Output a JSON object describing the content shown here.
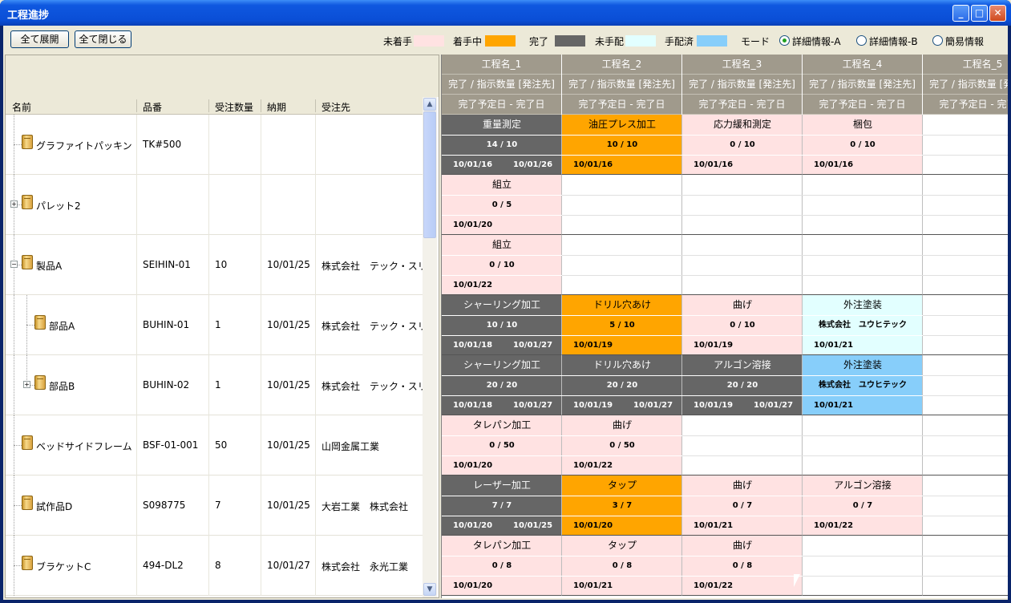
{
  "window": {
    "title": "工程進捗",
    "minimize": "_",
    "maximize": "□",
    "close": "✕"
  },
  "toolbar": {
    "expand_all": "全て展開",
    "collapse_all": "全て閉じる",
    "legend": [
      {
        "label": "未着手",
        "color": "#ffe2e2"
      },
      {
        "label": "着手中",
        "color": "#ffa500"
      },
      {
        "label": "完了",
        "color": "#666666"
      },
      {
        "label": "未手配",
        "color": "#e2ffff"
      },
      {
        "label": "手配済",
        "color": "#87cefa"
      }
    ],
    "mode_label": "モード",
    "modes": [
      {
        "label": "詳細情報-A",
        "selected": true
      },
      {
        "label": "詳細情報-B",
        "selected": false
      },
      {
        "label": "簡易情報",
        "selected": false
      }
    ]
  },
  "left_headers": {
    "name": "名前",
    "part": "品番",
    "qty": "受注数量",
    "due": "納期",
    "customer": "受注先"
  },
  "items": [
    {
      "name": "グラファイトパッキン",
      "part": "TK#500",
      "qty": "",
      "due": "",
      "customer": ""
    },
    {
      "name": "パレット2",
      "part": "",
      "qty": "",
      "due": "",
      "customer": "",
      "expander": "+"
    },
    {
      "name": "製品A",
      "part": "SEIHIN-01",
      "qty": "10",
      "due": "10/01/25",
      "customer": "株式会社　テック・スリー",
      "expander": "−"
    },
    {
      "name": "部品A",
      "part": "BUHIN-01",
      "qty": "1",
      "due": "10/01/25",
      "customer": "株式会社　テック・スリー"
    },
    {
      "name": "部品B",
      "part": "BUHIN-02",
      "qty": "1",
      "due": "10/01/25",
      "customer": "株式会社　テック・スリー",
      "expander": "+"
    },
    {
      "name": "ベッドサイドフレーム",
      "part": "BSF-01-001",
      "qty": "50",
      "due": "10/01/25",
      "customer": "山岡金属工業"
    },
    {
      "name": "試作品D",
      "part": "S098775",
      "qty": "7",
      "due": "10/01/25",
      "customer": "大岩工業　株式会社"
    },
    {
      "name": "ブラケットC",
      "part": "494-DL2",
      "qty": "8",
      "due": "10/01/27",
      "customer": "株式会社　永光工業"
    }
  ],
  "grid_headers": {
    "processes": [
      "工程名_1",
      "工程名_2",
      "工程名_3",
      "工程名_4",
      "工程名_5"
    ],
    "row2": "完了 / 指示数量 [発注先]",
    "row3": "完了予定日 - 完了日"
  },
  "grid": [
    [
      {
        "status": "done",
        "name": "重量測定",
        "qty": "14 / 10",
        "d1": "10/01/16",
        "d2": "10/01/26"
      },
      {
        "status": "progress",
        "name": "油圧プレス加工",
        "qty": "10 / 10",
        "d1": "10/01/16",
        "d2": ""
      },
      {
        "status": "notstart",
        "name": "応力緩和測定",
        "qty": "0 / 10",
        "d1": "10/01/16",
        "d2": ""
      },
      {
        "status": "notstart",
        "name": "梱包",
        "qty": "0 / 10",
        "d1": "10/01/16",
        "d2": ""
      },
      {
        "status": "empty"
      }
    ],
    [
      {
        "status": "notstart",
        "name": "組立",
        "qty": "0 / 5",
        "d1": "10/01/20",
        "d2": ""
      },
      {
        "status": "empty"
      },
      {
        "status": "empty"
      },
      {
        "status": "empty"
      },
      {
        "status": "empty"
      }
    ],
    [
      {
        "status": "notstart",
        "name": "組立",
        "qty": "0 / 10",
        "d1": "10/01/22",
        "d2": ""
      },
      {
        "status": "empty"
      },
      {
        "status": "empty"
      },
      {
        "status": "empty"
      },
      {
        "status": "empty"
      }
    ],
    [
      {
        "status": "done",
        "name": "シャーリング加工",
        "qty": "10 / 10",
        "d1": "10/01/18",
        "d2": "10/01/27"
      },
      {
        "status": "progress",
        "name": "ドリル穴あけ",
        "qty": "5 / 10",
        "d1": "10/01/19",
        "d2": ""
      },
      {
        "status": "notstart",
        "name": "曲げ",
        "qty": "0 / 10",
        "d1": "10/01/19",
        "d2": ""
      },
      {
        "status": "unarranged",
        "name": "外注塗装",
        "qty": "株式会社　ユウヒテック",
        "d1": "10/01/21",
        "d2": ""
      },
      {
        "status": "empty"
      }
    ],
    [
      {
        "status": "done",
        "name": "シャーリング加工",
        "qty": "20 / 20",
        "d1": "10/01/18",
        "d2": "10/01/27"
      },
      {
        "status": "done",
        "name": "ドリル穴あけ",
        "qty": "20 / 20",
        "d1": "10/01/19",
        "d2": "10/01/27"
      },
      {
        "status": "done",
        "name": "アルゴン溶接",
        "qty": "20 / 20",
        "d1": "10/01/19",
        "d2": "10/01/27"
      },
      {
        "status": "arranged",
        "name": "外注塗装",
        "qty": "株式会社　ユウヒテック",
        "d1": "10/01/21",
        "d2": ""
      },
      {
        "status": "empty"
      }
    ],
    [
      {
        "status": "notstart",
        "name": "タレパン加工",
        "qty": "0 / 50",
        "d1": "10/01/20",
        "d2": ""
      },
      {
        "status": "notstart",
        "name": "曲げ",
        "qty": "0 / 50",
        "d1": "10/01/22",
        "d2": ""
      },
      {
        "status": "empty"
      },
      {
        "status": "empty"
      },
      {
        "status": "empty"
      }
    ],
    [
      {
        "status": "done",
        "name": "レーザー加工",
        "qty": "7 / 7",
        "d1": "10/01/20",
        "d2": "10/01/25"
      },
      {
        "status": "progress",
        "name": "タップ",
        "qty": "3 / 7",
        "d1": "10/01/20",
        "d2": ""
      },
      {
        "status": "notstart",
        "name": "曲げ",
        "qty": "0 / 7",
        "d1": "10/01/21",
        "d2": ""
      },
      {
        "status": "notstart",
        "name": "アルゴン溶接",
        "qty": "0 / 7",
        "d1": "10/01/22",
        "d2": ""
      },
      {
        "status": "empty"
      }
    ],
    [
      {
        "status": "notstart",
        "name": "タレパン加工",
        "qty": "0 / 8",
        "d1": "10/01/20",
        "d2": ""
      },
      {
        "status": "notstart",
        "name": "タップ",
        "qty": "0 / 8",
        "d1": "10/01/21",
        "d2": ""
      },
      {
        "status": "notstart",
        "name": "曲げ",
        "qty": "0 / 8",
        "d1": "10/01/22",
        "d2": ""
      },
      {
        "status": "empty"
      },
      {
        "status": "empty"
      }
    ]
  ]
}
